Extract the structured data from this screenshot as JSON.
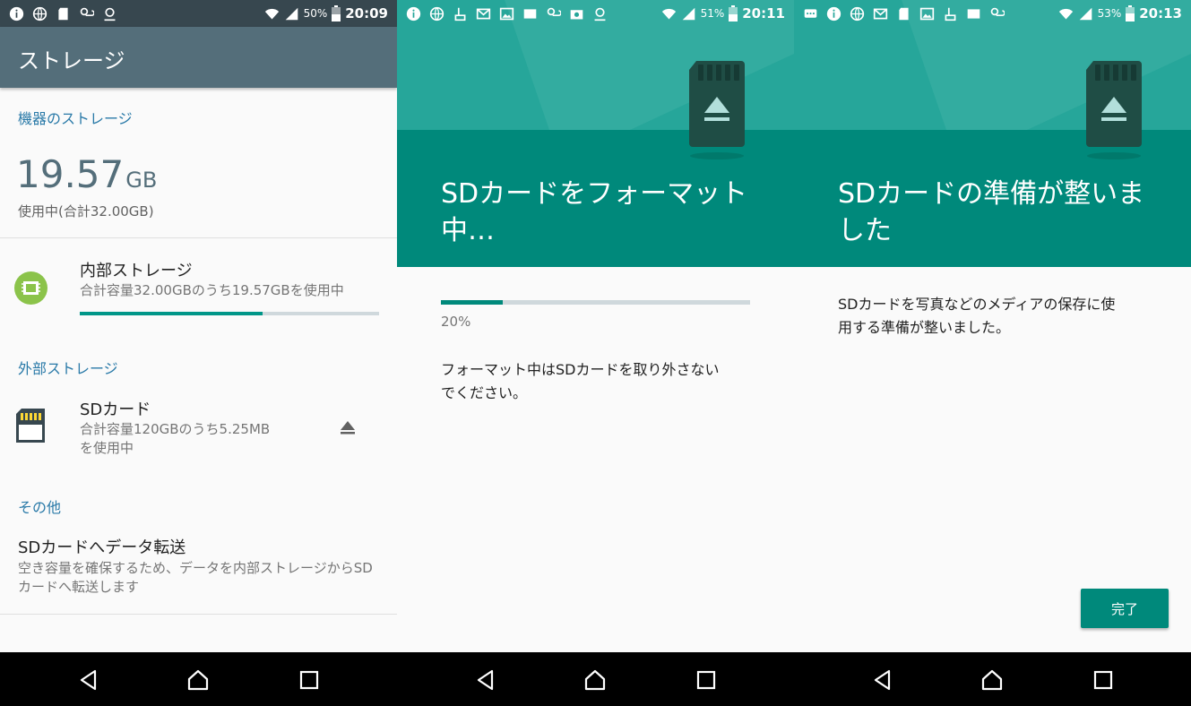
{
  "panel1": {
    "status": {
      "battery": "50%",
      "time": "20:09"
    },
    "title": "ストレージ",
    "device_section": "機器のストレージ",
    "used_value": "19.57",
    "used_unit": "GB",
    "used_total": "使用中(合計32.00GB)",
    "internal": {
      "title": "内部ストレージ",
      "subtitle": "合計容量32.00GBのうち19.57GBを使用中",
      "usage_fraction": 0.61
    },
    "external_section": "外部ストレージ",
    "sd": {
      "title": "SDカード",
      "subtitle_line1": "合計容量120GBのうち5.25MB",
      "subtitle_line2": "を使用中"
    },
    "other_section": "その他",
    "transfer": {
      "title": "SDカードへデータ転送",
      "subtitle": "空き容量を確保するため、データを内部ストレージからSDカードへ転送します"
    }
  },
  "panel2": {
    "status": {
      "battery": "51%",
      "time": "20:11"
    },
    "title_line1": "SDカードをフォーマット",
    "title_line2": "中…",
    "progress_text": "20%",
    "progress_fraction": 0.2,
    "message_line1": "フォーマット中はSDカードを取り外さない",
    "message_line2": "でください。"
  },
  "panel3": {
    "status": {
      "battery": "53%",
      "time": "20:13"
    },
    "title_line1": "SDカードの準備が整いま",
    "title_line2": "した",
    "message_line1": "SDカードを写真などのメディアの保存に使",
    "message_line2": "用する準備が整いました。",
    "done_label": "完了"
  },
  "colors": {
    "accent": "#00897b",
    "header_light": "#26a69a",
    "appbar": "#546e7a",
    "section_blue": "#2a7aa8"
  },
  "icons": [
    "info-icon",
    "globe-icon",
    "sd-card-icon",
    "weather-icon",
    "location-icon",
    "email-icon",
    "image-icon",
    "wifi-icon",
    "signal-icon",
    "battery-icon",
    "chip-icon",
    "eject-icon",
    "back-icon",
    "home-icon",
    "recents-icon"
  ]
}
